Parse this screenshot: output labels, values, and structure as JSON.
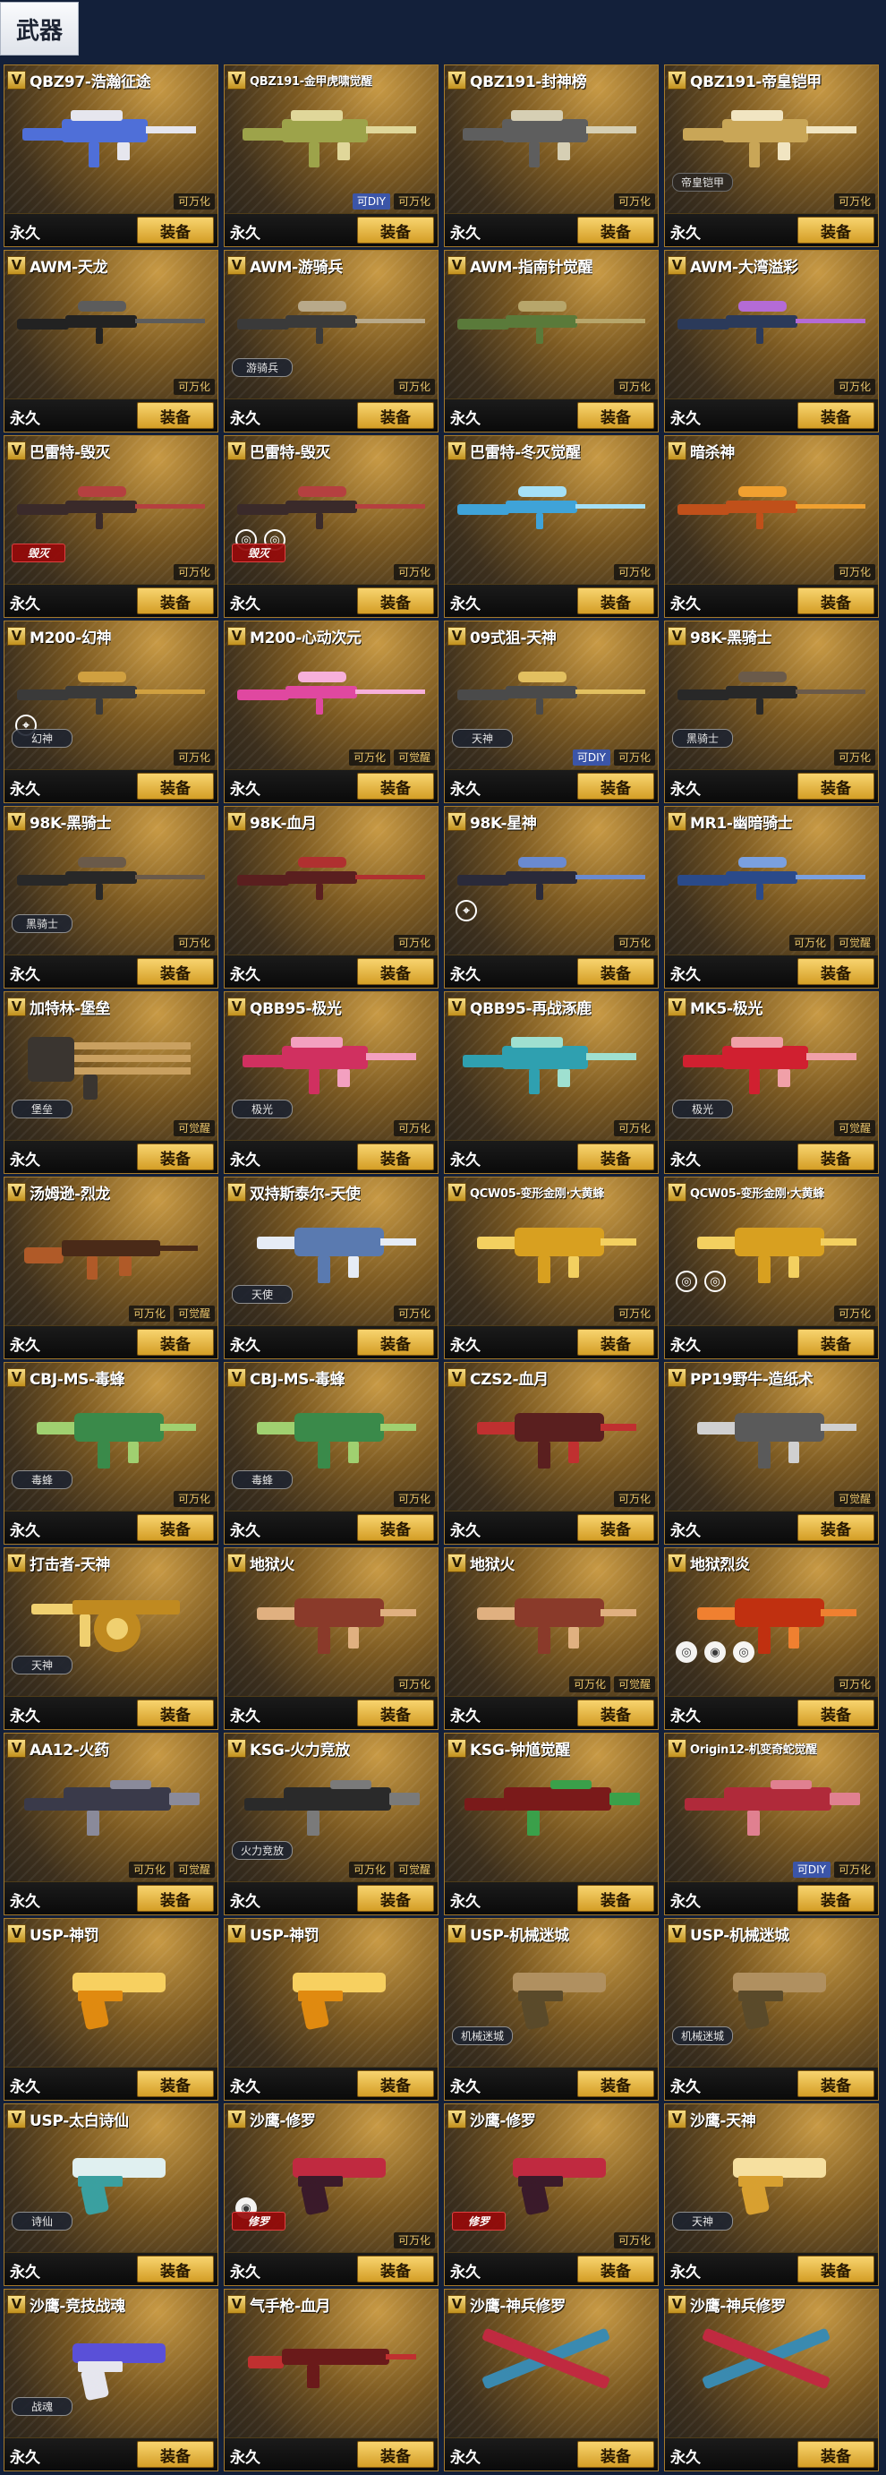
{
  "tab": {
    "label": "武器"
  },
  "footer": {
    "duration": "永久",
    "equip_label": "装备"
  },
  "vip_badge": "V",
  "cards": [
    {
      "name": "QBZ97-浩瀚征途",
      "weapon": "rifle",
      "colors": [
        "#4f6fd8",
        "#e6e6ee"
      ],
      "tags": [
        "可万化"
      ]
    },
    {
      "name": "QBZ191-金甲虎啸觉醒",
      "weapon": "rifle",
      "colors": [
        "#9da34a",
        "#e0d79a"
      ],
      "tags": [
        "可DIY",
        "可万化"
      ],
      "small": true
    },
    {
      "name": "QBZ191-封神榜",
      "weapon": "rifle",
      "colors": [
        "#5e5e5e",
        "#d6cfb4"
      ],
      "tags": [
        "可万化"
      ]
    },
    {
      "name": "QBZ191-帝皇铠甲",
      "weapon": "rifle",
      "colors": [
        "#c9a657",
        "#f1e5c2"
      ],
      "chip": "帝皇铠甲",
      "chip_type": "dark",
      "tags": [
        "可万化"
      ]
    },
    {
      "name": "AWM-天龙",
      "weapon": "sniper",
      "colors": [
        "#222222",
        "#5c5c5c"
      ],
      "tags": [
        "可万化"
      ]
    },
    {
      "name": "AWM-游骑兵",
      "weapon": "sniper",
      "colors": [
        "#3a3a3a",
        "#b8a98a"
      ],
      "chip": "游骑兵",
      "tags": [
        "可万化"
      ]
    },
    {
      "name": "AWM-指南针觉醒",
      "weapon": "sniper",
      "colors": [
        "#5a7a3a",
        "#b7a66b"
      ],
      "tags": [
        "可万化"
      ]
    },
    {
      "name": "AWM-大湾溢彩",
      "weapon": "sniper",
      "colors": [
        "#2b3a5a",
        "#b46bd6"
      ],
      "tags": [
        "可万化"
      ]
    },
    {
      "name": "巴雷特-毁灭",
      "weapon": "sniper",
      "colors": [
        "#3a2a2a",
        "#b54040"
      ],
      "chip": "毁灭",
      "chip_type": "red",
      "tags": [
        "可万化"
      ]
    },
    {
      "name": "巴雷特-毁灭",
      "weapon": "sniper",
      "colors": [
        "#3a2a2a",
        "#b54040"
      ],
      "chip": "毁灭",
      "chip_type": "red",
      "icons": [
        "◎",
        "◎"
      ],
      "icon_style": "plain",
      "tags": [
        "可万化"
      ]
    },
    {
      "name": "巴雷特-冬灭觉醒",
      "weapon": "sniper",
      "colors": [
        "#3fa3d8",
        "#a5e0f6"
      ],
      "tags": [
        "可万化"
      ]
    },
    {
      "name": "暗杀神",
      "weapon": "sniper",
      "colors": [
        "#c0501a",
        "#f0a030"
      ],
      "tags": [
        "可万化"
      ]
    },
    {
      "name": "M200-幻神",
      "weapon": "sniper",
      "colors": [
        "#3a3a3a",
        "#d0a040"
      ],
      "chip": "幻神",
      "icons": [
        "⌖"
      ],
      "icon_style": "plain",
      "tags": [
        "可万化"
      ]
    },
    {
      "name": "M200-心动次元",
      "weapon": "sniper",
      "colors": [
        "#e048a0",
        "#f7b0da"
      ],
      "tags": [
        "可万化",
        "可觉醒"
      ]
    },
    {
      "name": "09式狙-天神",
      "weapon": "sniper",
      "colors": [
        "#4a4a4a",
        "#e2c060"
      ],
      "chip": "天神",
      "tags": [
        "可DIY",
        "可万化"
      ]
    },
    {
      "name": "98K-黑骑士",
      "weapon": "sniper",
      "colors": [
        "#282828",
        "#6a5a4a"
      ],
      "chip": "黑骑士",
      "tags": [
        "可万化"
      ]
    },
    {
      "name": "98K-黑骑士",
      "weapon": "sniper",
      "colors": [
        "#282828",
        "#6a5a4a"
      ],
      "chip": "黑骑士",
      "tags": [
        "可万化"
      ]
    },
    {
      "name": "98K-血月",
      "weapon": "sniper",
      "colors": [
        "#5a1f1f",
        "#b03030"
      ],
      "tags": [
        "可万化"
      ]
    },
    {
      "name": "98K-星神",
      "weapon": "sniper",
      "colors": [
        "#2a2a3a",
        "#6a8ad0"
      ],
      "icons": [
        "⌖"
      ],
      "icon_style": "plain",
      "tags": [
        "可万化"
      ]
    },
    {
      "name": "MR1-幽暗骑士",
      "weapon": "sniper",
      "colors": [
        "#2a4a8a",
        "#7aa0e0"
      ],
      "tags": [
        "可万化",
        "可觉醒"
      ]
    },
    {
      "name": "加特林-堡垒",
      "weapon": "gatling",
      "colors": [
        "#3a3530",
        "#c9a060"
      ],
      "chip": "堡垒",
      "tags": [
        "可觉醒"
      ]
    },
    {
      "name": "QBB95-极光",
      "weapon": "rifle",
      "colors": [
        "#d03060",
        "#f3a0c0"
      ],
      "chip": "极光",
      "tags": [
        "可万化"
      ]
    },
    {
      "name": "QBB95-再战涿鹿",
      "weapon": "rifle",
      "colors": [
        "#2fa0b0",
        "#9fe0d0"
      ],
      "tags": [
        "可万化"
      ]
    },
    {
      "name": "MK5-极光",
      "weapon": "rifle",
      "colors": [
        "#d02030",
        "#f0a0a8"
      ],
      "chip": "极光",
      "tags": [
        "可觉醒"
      ]
    },
    {
      "name": "汤姆逊-烈龙",
      "weapon": "tommy",
      "colors": [
        "#4a2a18",
        "#b05a28"
      ],
      "tags": [
        "可万化",
        "可觉醒"
      ]
    },
    {
      "name": "双持斯泰尔-天使",
      "weapon": "smg",
      "colors": [
        "#5a7ab0",
        "#e6ecf6"
      ],
      "chip": "天使",
      "tags": [
        "可万化"
      ]
    },
    {
      "name": "QCW05-变形金刚·大黄蜂",
      "weapon": "smg",
      "colors": [
        "#d8a020",
        "#f3d060"
      ],
      "tags": [
        "可万化"
      ],
      "small": true
    },
    {
      "name": "QCW05-变形金刚·大黄蜂",
      "weapon": "smg",
      "colors": [
        "#d8a020",
        "#f3d060"
      ],
      "icons": [
        "◎",
        "◎"
      ],
      "icon_style": "plain",
      "tags": [
        "可万化"
      ],
      "small": true
    },
    {
      "name": "CBJ-MS-毒蜂",
      "weapon": "smg",
      "colors": [
        "#3a8a4a",
        "#a0d070"
      ],
      "chip": "毒蜂",
      "tags": [
        "可万化"
      ]
    },
    {
      "name": "CBJ-MS-毒蜂",
      "weapon": "smg",
      "colors": [
        "#3a8a4a",
        "#a0d070"
      ],
      "chip": "毒蜂",
      "tags": [
        "可万化"
      ]
    },
    {
      "name": "CZS2-血月",
      "weapon": "smg",
      "colors": [
        "#5a1f1f",
        "#c03030"
      ],
      "tags": [
        "可万化"
      ]
    },
    {
      "name": "PP19野牛-造纸术",
      "weapon": "smg",
      "colors": [
        "#5a5a5a",
        "#d0d0d0"
      ],
      "tags": [
        "可觉醒"
      ]
    },
    {
      "name": "打击者-天神",
      "weapon": "drum",
      "colors": [
        "#c08a20",
        "#f0d070"
      ],
      "chip": "天神",
      "tags": []
    },
    {
      "name": "地狱火",
      "weapon": "smg",
      "colors": [
        "#8a3a2a",
        "#e0b080"
      ],
      "tags": [
        "可万化"
      ]
    },
    {
      "name": "地狱火",
      "weapon": "smg",
      "colors": [
        "#8a3a2a",
        "#e0b080"
      ],
      "tags": [
        "可万化",
        "可觉醒"
      ]
    },
    {
      "name": "地狱烈炎",
      "weapon": "smg",
      "colors": [
        "#c03010",
        "#f08030"
      ],
      "icons": [
        "◎",
        "◉",
        "◎"
      ],
      "icon_style": "solid",
      "tags": [
        "可万化"
      ]
    },
    {
      "name": "AA12-火药",
      "weapon": "shotgun",
      "colors": [
        "#3a3a4a",
        "#8a8a9a"
      ],
      "tags": [
        "可万化",
        "可觉醒"
      ]
    },
    {
      "name": "KSG-火力竞放",
      "weapon": "shotgun",
      "colors": [
        "#2a2a2a",
        "#7a7a7a"
      ],
      "chip": "火力竞放",
      "tags": [
        "可万化",
        "可觉醒"
      ]
    },
    {
      "name": "KSG-钟馗觉醒",
      "weapon": "shotgun",
      "colors": [
        "#7a1a1a",
        "#3aa04a"
      ],
      "tags": []
    },
    {
      "name": "Origin12-机变奇蛇觉醒",
      "weapon": "shotgun",
      "colors": [
        "#b02a3a",
        "#e08090"
      ],
      "tags": [
        "可DIY",
        "可万化"
      ],
      "small": true
    },
    {
      "name": "USP-神罚",
      "weapon": "pistol",
      "colors": [
        "#e08a10",
        "#f7d060"
      ],
      "tags": []
    },
    {
      "name": "USP-神罚",
      "weapon": "pistol",
      "colors": [
        "#e08a10",
        "#f7d060"
      ],
      "tags": []
    },
    {
      "name": "USP-机械迷城",
      "weapon": "pistol",
      "colors": [
        "#5a4a2a",
        "#b09060"
      ],
      "chip": "机械迷城",
      "tags": []
    },
    {
      "name": "USP-机械迷城",
      "weapon": "pistol",
      "colors": [
        "#5a4a2a",
        "#b09060"
      ],
      "chip": "机械迷城",
      "tags": []
    },
    {
      "name": "USP-太白诗仙",
      "weapon": "pistol",
      "colors": [
        "#3aa0a0",
        "#e0f0f0"
      ],
      "chip": "诗仙",
      "tags": []
    },
    {
      "name": "沙鹰-修罗",
      "weapon": "pistol",
      "colors": [
        "#3a1a2a",
        "#c02a40"
      ],
      "chip": "修罗",
      "chip_type": "red",
      "icons": [
        "◉"
      ],
      "icon_style": "solid",
      "tags": [
        "可万化"
      ]
    },
    {
      "name": "沙鹰-修罗",
      "weapon": "pistol",
      "colors": [
        "#3a1a2a",
        "#c02a40"
      ],
      "chip": "修罗",
      "chip_type": "red",
      "tags": [
        "可万化"
      ]
    },
    {
      "name": "沙鹰-天神",
      "weapon": "pistol",
      "colors": [
        "#d8a030",
        "#f6e0a0"
      ],
      "chip": "天神",
      "tags": []
    },
    {
      "name": "沙鹰-竞技战魂",
      "weapon": "pistol",
      "colors": [
        "#e6e6ee",
        "#5a50d8"
      ],
      "chip": "战魂",
      "tags": []
    },
    {
      "name": "气手枪-血月",
      "weapon": "airgun",
      "colors": [
        "#6a1a1a",
        "#c03030"
      ],
      "tags": []
    },
    {
      "name": "沙鹰-神兵修罗",
      "weapon": "dual",
      "colors": [
        "#3a8ab0",
        "#c02a40"
      ],
      "tags": []
    },
    {
      "name": "沙鹰-神兵修罗",
      "weapon": "dual",
      "colors": [
        "#3a8ab0",
        "#c02a40"
      ],
      "tags": []
    }
  ]
}
